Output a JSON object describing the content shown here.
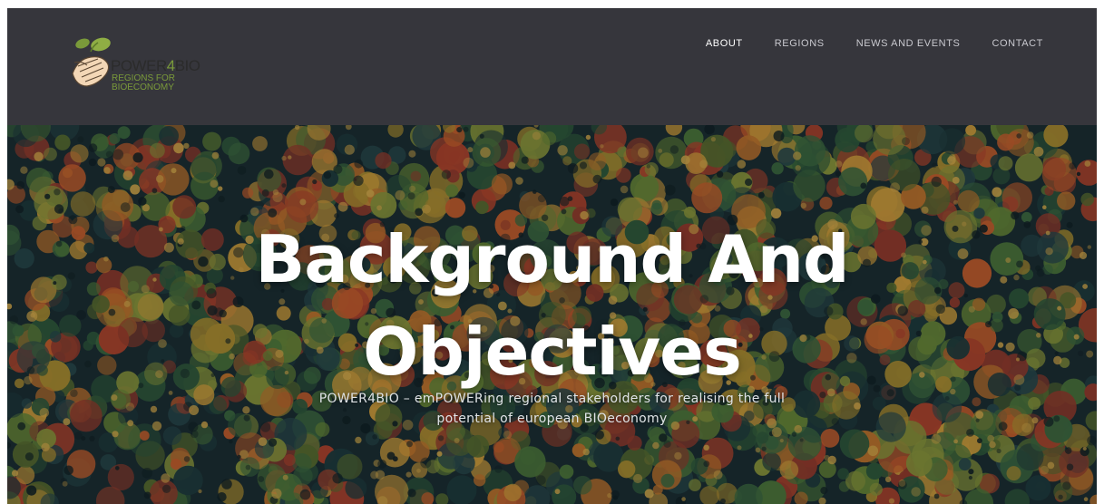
{
  "logo": {
    "title_part1": "POWER",
    "title_part2": "4",
    "title_part3": "BIO",
    "subtitle_line1": "REGIONS FOR",
    "subtitle_line2": "BIOECONOMY",
    "brand_color": "#7a9a3a"
  },
  "nav": {
    "items": [
      {
        "label": "ABOUT",
        "active": true
      },
      {
        "label": "REGIONS",
        "active": false
      },
      {
        "label": "NEWS AND EVENTS",
        "active": false
      },
      {
        "label": "CONTACT",
        "active": false
      }
    ]
  },
  "hero": {
    "title_line1": "Background And",
    "title_line2": "Objectives",
    "subtitle_line1": "POWER4BIO – emPOWERing regional stakeholders for realising the full",
    "subtitle_line2": "potential of european BIOeconomy"
  },
  "colors": {
    "header_bg": "#36363c",
    "nav_text": "#c9c9cf",
    "nav_active": "#ffffff",
    "hero_text": "#ffffff"
  }
}
